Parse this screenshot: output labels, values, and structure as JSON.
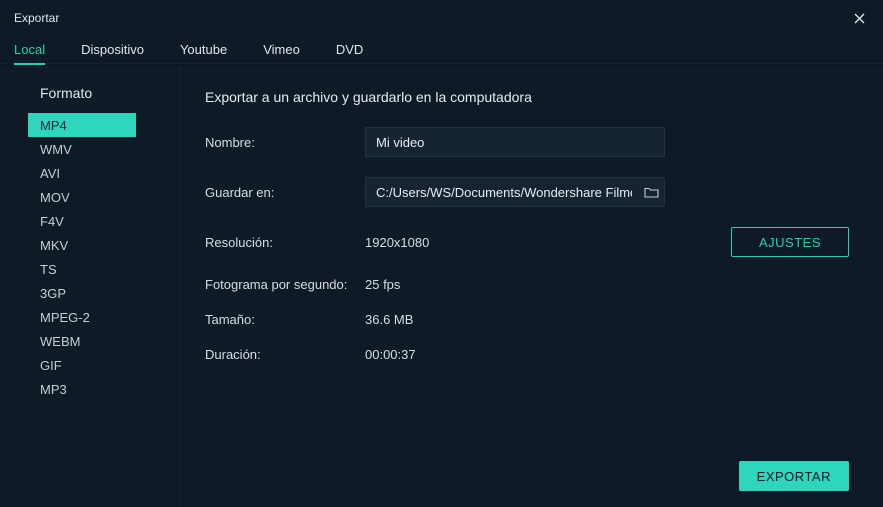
{
  "titlebar": {
    "title": "Exportar"
  },
  "tabs": [
    {
      "label": "Local",
      "active": true
    },
    {
      "label": "Dispositivo",
      "active": false
    },
    {
      "label": "Youtube",
      "active": false
    },
    {
      "label": "Vimeo",
      "active": false
    },
    {
      "label": "DVD",
      "active": false
    }
  ],
  "sidebar": {
    "title": "Formato",
    "formats": [
      {
        "label": "MP4",
        "selected": true
      },
      {
        "label": "WMV",
        "selected": false
      },
      {
        "label": "AVI",
        "selected": false
      },
      {
        "label": "MOV",
        "selected": false
      },
      {
        "label": "F4V",
        "selected": false
      },
      {
        "label": "MKV",
        "selected": false
      },
      {
        "label": "TS",
        "selected": false
      },
      {
        "label": "3GP",
        "selected": false
      },
      {
        "label": "MPEG-2",
        "selected": false
      },
      {
        "label": "WEBM",
        "selected": false
      },
      {
        "label": "GIF",
        "selected": false
      },
      {
        "label": "MP3",
        "selected": false
      }
    ]
  },
  "main": {
    "heading": "Exportar a un archivo y guardarlo en la computadora",
    "name_label": "Nombre:",
    "name_value": "Mi video",
    "save_label": "Guardar en:",
    "save_value": "C:/Users/WS/Documents/Wondershare Filmora",
    "resolution_label": "Resolución:",
    "resolution_value": "1920x1080",
    "fps_label": "Fotograma por segundo:",
    "fps_value": "25 fps",
    "size_label": "Tamaño:",
    "size_value": "36.6 MB",
    "duration_label": "Duración:",
    "duration_value": "00:00:37",
    "settings_button": "AJUSTES",
    "export_button": "EXPORTAR"
  }
}
